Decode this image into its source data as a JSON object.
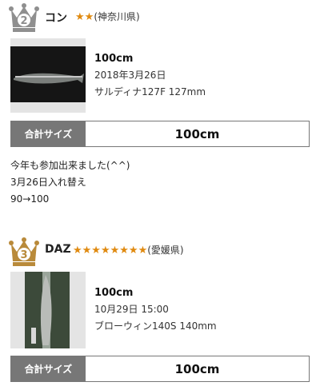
{
  "entries": [
    {
      "rank": "2",
      "name": "コン",
      "stars": "★★",
      "prefecture": "(神奈川県)",
      "length": "100cm",
      "date": "2018年3月26日",
      "lure": "サルディナ127F 127mm",
      "total_label": "合計サイズ",
      "total_value": "100cm",
      "comment": [
        "今年も参加出来ました(^^)",
        "3月26日入れ替え",
        "90→100"
      ]
    },
    {
      "rank": "3",
      "name": "DAZ",
      "stars": "★★★★★★★★",
      "prefecture": "(愛媛県)",
      "length": "100cm",
      "date": "10月29日 15:00",
      "lure": "ブローウィン140S 140mm",
      "total_label": "合計サイズ",
      "total_value": "100cm"
    }
  ],
  "colors": {
    "silver_crown": "#8f8f8f",
    "bronze_crown": "#b98a3a",
    "star": "#e08a10",
    "label_bg": "#777777"
  }
}
